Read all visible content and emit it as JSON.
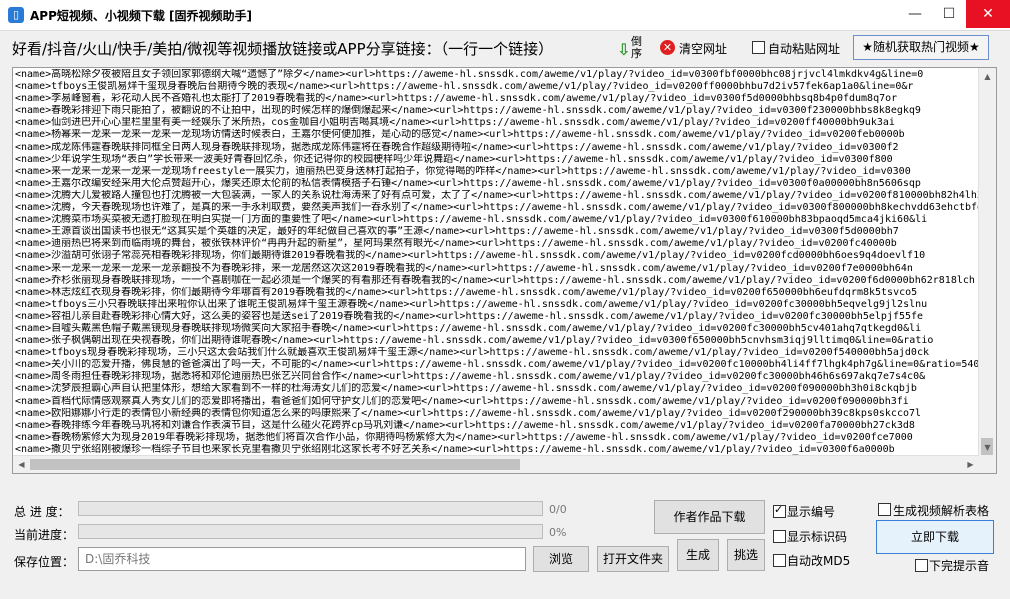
{
  "window": {
    "title": "APP短视频、小视频下载 [固乔视频助手]",
    "min": "—",
    "max": "☐",
    "close": "✕"
  },
  "prompt": "好看/抖音/火山/快手/美拍/微视等视频播放链接或APP分享链接：（一行一个链接）",
  "toolbar": {
    "download_side_label": "倒序",
    "clear_label": "清空网址",
    "auto_paste_label": "自动粘贴网址",
    "random_hot_label": "★随机获取热门视频★"
  },
  "list_lines": [
    "<name>高晓松除夕夜被陪且女子领回家郭德纲大喊“遗憾了”除夕</name><url>https://aweme-hl.snssdk.com/aweme/v1/play/?video_id=v0300fbf0000bhc08jrjvcl4lmkdkv4g&line=0",
    "<name>tfboys王俊凯易烊千玺现身春晚后台期待今晚的表现</name><url>https://aweme-hl.snssdk.com/aweme/v1/play/?video_id=v0200ff0000bhbu7d2iv57fek6ap1a0&line=0&r",
    "<name>李易峰窗着，彩花动人民不吝婚礼也太能打了2019春晚看我的</name><url>https://aweme-hl.snssdk.com/aweme/v1/play/?video_id=v0300f5d0000bhbsq8b4p0fdum8q7or",
    "<name>春晚彩排迎下雨只能拍了，被翻说的不让拍中，出现的时候怎样的爆倒爆起来</name><url>https://aweme-hl.snssdk.com/aweme/v1/play/?video_id=v0300f230000bhbs8k8egkq9",
    "<name>仙剑进巴开心心里栏里里有美一经娱乐了米所热，cos金咖自小姐明吉喝其境</name><url>https://aweme-hl.snssdk.com/aweme/v1/play/?video_id=v0200ff40000bh9uk3ai",
    "<name>杨幂来一龙来一龙来一龙来一龙现场访情送时候表白，王嘉尔使何便加推，是心动的感觉</name><url>https://aweme-hl.snssdk.com/aweme/v1/play/?video_id=v0200feb0000b",
    "<name>成龙陈伟霆春晚联排同框全日两人现身春晚联排现场，据悉成龙陈伟霆将在春晚合作超级期待啦</name><url>https://aweme-hl.snssdk.com/aweme/v1/play/?video_id=v0300f2",
    "<name>少年说学生现场“表白”学长带来一波美好青春回忆杀，你还记得你的校园梗样吗少年说舞蹈</name><url>https://aweme-hl.snssdk.com/aweme/v1/play/?video_id=v0300f800",
    "<name>来一龙来一龙来一龙来一龙现场freestyle一展实力，迪丽热巴变身送林打起拍子，你觉得喝的咋样</name><url>https://aweme-hl.snssdk.com/aweme/v1/play/?video_id=v0300",
    "<name>王嘉尔改编安经采用大伦点赞超开心，爆笑还原太伦前的私信表情模搭子石锤</name><url>https://aweme-hl.snssdk.com/aweme/v1/play/?video_id=v0300f0a00000bh8n5606sqp",
    "<name>沈腾大儿爱被路人撞包也打沈腾被一大包装满，一家人的关系说杜海涛来了好有点可爱，太了了</name><url>https://aweme-hl.snssdk.com/aweme/v1/play/?video_id=v0200f810000bh82h4lh34",
    "<name>沈腾，今天春晚现场也许难了，是真的来一手永利取费，要然美声我们一吞永别了</name><url>https://aweme-hl.snssdk.com/aweme/v1/play/?video_id=v0300f800000bh8kechvdd63ehctbfg&line=0&ratio=540",
    "<name>沈腾菜市场买菜被无遗打脸现在明白实提一门方面的重要性了吧</name><url>https://aweme-hl.snssdk.com/aweme/v1/play/?video_id=v0300f610000bh83bpaoqd5mca4jki60&li",
    "<name>王源首谈出国读书也很无“这其实是个英雄的决定，最好的年纪做自己喜欢的事”王源</name><url>https://aweme-hl.snssdk.com/aweme/v1/play/?video_id=v0300f5d0000bh7",
    "<name>迪丽热巴将来到而临雨境的舞台，被张铁林评价“冉冉升起的新星”，星阿玛果然有眼光</name><url>https://aweme-hl.snssdk.com/aweme/v1/play/?video_id=v0200fc40000b",
    "<name>沙溢胡可张诩子常蕊亮相春晚彩排现场，你们最期待谁2019春晚看我的</name><url>https://aweme-hl.snssdk.com/aweme/v1/play/?video_id=v0200fcd0000bh6oes9q4doevlf10",
    "<name>来一龙来一龙来一龙来一龙亲翻投不为春晚彩排，来一龙居然这次这2019春晚看我的</name><url>https://aweme-hl.snssdk.com/aweme/v1/play/?video_id=v0200f7e0000bh64n",
    "<name>乔杉张丽现身春晚联排现场，一一个喜剧咖在一起必须是一个爆笑的有看那还有春晚看我的</name><url>https://aweme-hl.snssdk.com/aweme/v1/play/?video_id=v0200f6d0000bh62r818lch",
    "<name>林志炫红衣现身春晚彩排，你们最期待今年哪首有2019春晚看我的</name><url>https://aweme-hl.snssdk.com/aweme/v1/play/?video_id=v0200f650000bh6eufdqrm8k5tsvco5",
    "<name>tfboys三小只春晚联排出来啦你认出来了谁呢王俊凯易烊千玺王源春晚</name><url>https://aweme-hl.snssdk.com/aweme/v1/play/?video_id=v0200fc30000bh5eqvelg9jl2slnu",
    "<name>容祖儿亲自赴春晚彩排心情大好，这么美的姿容也是送sei了2019春晚看我的</name><url>https://aweme-hl.snssdk.com/aweme/v1/play/?video_id=v0200fc30000bh5elpjf55fe",
    "<name>自嘘头戴黑色帽子戴黑镜现身春晚联排现场微笑向大家招手春晚</name><url>https://aweme-hl.snssdk.com/aweme/v1/play/?video_id=v0200fc30000bh5cv401ahq7qtkegd0&li",
    "<name>张子枫偶朝出现在央视春晚，你们出期待谁呢春晚</name><url>https://aweme-hl.snssdk.com/aweme/v1/play/?video_id=v0300f650000bh5cnvhsm3iqj9lltimq0&line=0&ratio",
    "<name>tfboys现身春晚彩排现场，三小只这太会站我们什么就最喜欢王俊凯易烊千玺王源</name><url>https://aweme-hl.snssdk.com/aweme/v1/play/?video_id=v0200f540000bh5ajd0ck",
    "<name>关小川的恋爱开播，佛良慧的爸爸演出了吗一天，不可能的</name><url>https://aweme-hl.snssdk.com/aweme/v1/play/?video_id=v0200fc10000bh4li4ff7lhgk4ph7g&line=0&ratio=540",
    "<name>周冬雨担任春晚彩排现场，据悉将和邓伦迪丽热巴张艺兴同台合作</name><url>https://aweme-hl.snssdk.com/aweme/v1/play/?video_id=v0200fc30000bh46h6s697akq7e7s4c0&",
    "<name>沈梦辰担霸心声自认把里体形，想给大家看到不一样的杜海涛女儿们的恋爱</name><url>https://aweme-hl.snssdk.com/aweme/v1/play/?video_id=v0200f090000bh3h0i8ckqbjb",
    "<name>首档代际情感观察真人秀女儿们的恋爱即将播出，看爸爸们如何守护女儿们的恋爱吧</name><url>https://aweme-hl.snssdk.com/aweme/v1/play/?video_id=v0200f090000bh3fi",
    "<name>欧阳娜娜小行走的表情包小新经典的表情包你知道怎么来的吗康熙来了</name><url>https://aweme-hl.snssdk.com/aweme/v1/play/?video_id=v0200f290000bh39c8kps0skcco7l",
    "<name>春晚排练今年春晚马巩将和刘谦合作表演节目，这是什么碰火花跨界cp马巩刘谦</name><url>https://aweme-hl.snssdk.com/aweme/v1/play/?video_id=v0200fa70000bh27ck3d8",
    "<name>春晚杨紫修大为现身2019年春晚彩排现场，据悉他们将首次合作小品，你期待吗杨紫修大为</name><url>https://aweme-hl.snssdk.com/aweme/v1/play/?video_id=v0200fce7000",
    "<name>撒贝宁张绍刚被爆珍一档综子节目也来家长克里看撒贝宁张绍刚北这家长考不好艺关系</name><url>https://aweme-hl.snssdk.com/aweme/v1/play/?video_id=v0300f6a0000b"
  ],
  "scroll": {
    "up": "▲",
    "down": "▼",
    "left": "◀",
    "right": "▶"
  },
  "progress": {
    "total_label": "总 进 度：",
    "total_value": "0/0",
    "total_fraction": 0,
    "current_label": "当前进度：",
    "current_value": "0%",
    "current_fraction": 0
  },
  "save": {
    "label": "保存位置：",
    "path": "D:\\固乔科技"
  },
  "buttons": {
    "browse": "浏览",
    "open_folder": "打开文件夹",
    "generate": "生成",
    "pick": "挑选",
    "author_download": "作者作品下载",
    "start_download": "立即下载"
  },
  "options": {
    "show_number": "显示编号",
    "show_number_checked": true,
    "show_mark": "显示标识码",
    "show_mark_checked": false,
    "auto_md5": "自动改MD5",
    "auto_md5_checked": false,
    "gen_parse_table": "生成视频解析表格",
    "gen_parse_table_checked": false,
    "finish_sound": "下完提示音",
    "finish_sound_checked": false
  }
}
